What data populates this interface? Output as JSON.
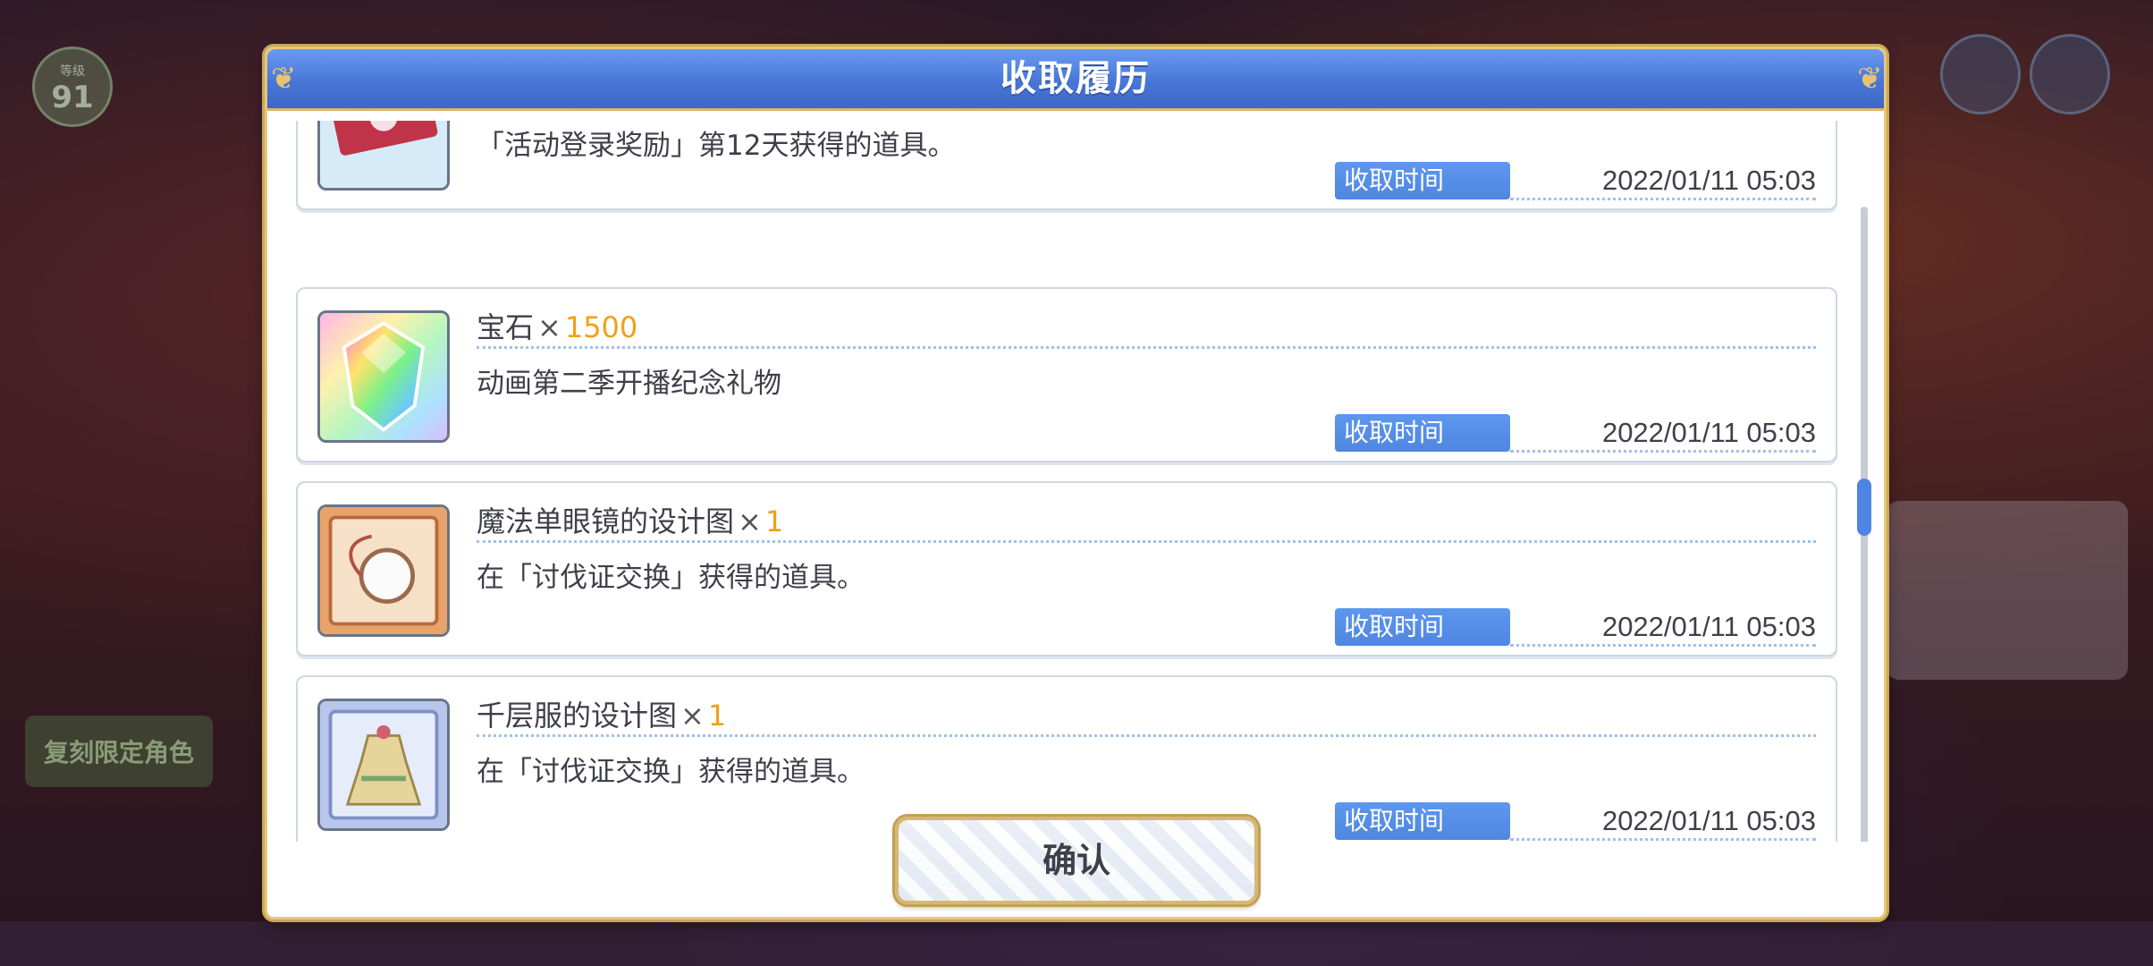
{
  "background": {
    "level_label": "等级",
    "level_value": "91",
    "banner_text": "复刻限定角色"
  },
  "dialog": {
    "title": "收取履历",
    "confirm_label": "确认",
    "items": [
      {
        "icon": "ticket-icon",
        "name": "",
        "times": "",
        "qty": "",
        "desc": "「活动登录奖励」第12天获得的道具。",
        "time_label": "收取时间",
        "time_value": "2022/01/11 05:03"
      },
      {
        "icon": "gem-icon",
        "name": "宝石",
        "times": "×",
        "qty": "1500",
        "desc": "动画第二季开播纪念礼物",
        "time_label": "收取时间",
        "time_value": "2022/01/11 05:03"
      },
      {
        "icon": "monocle-blueprint-icon",
        "name": "魔法单眼镜的设计图",
        "times": "×",
        "qty": "1",
        "desc": "在「讨伐证交换」获得的道具。",
        "time_label": "收取时间",
        "time_value": "2022/01/11 05:03"
      },
      {
        "icon": "dress-blueprint-icon",
        "name": "千层服的设计图",
        "times": "×",
        "qty": "1",
        "desc": "在「讨伐证交换」获得的道具。",
        "time_label": "收取时间",
        "time_value": "2022/01/11 05:03"
      }
    ]
  },
  "colors": {
    "title_bar": "#4876d8",
    "accent_gold": "#e7c77a",
    "qty_orange": "#f0a019",
    "time_label_bg": "#5d97ee"
  }
}
